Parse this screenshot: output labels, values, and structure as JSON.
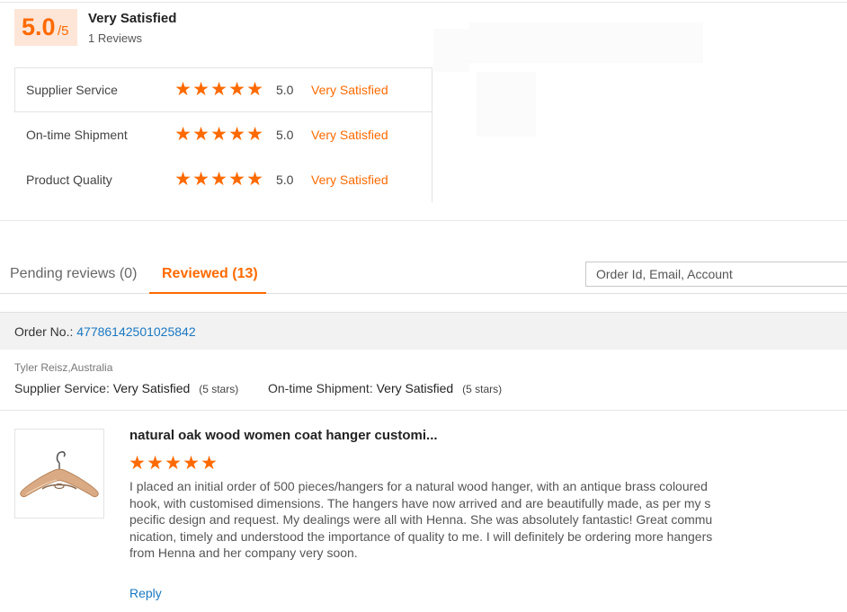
{
  "summary": {
    "score": "5.0",
    "score_max": "/5",
    "rating_text": "Very Satisfied",
    "review_count": "1 Reviews"
  },
  "rating_rows": [
    {
      "label": "Supplier Service",
      "stars": 5,
      "score": "5.0",
      "text": "Very Satisfied"
    },
    {
      "label": "On-time Shipment",
      "stars": 5,
      "score": "5.0",
      "text": "Very Satisfied"
    },
    {
      "label": "Product Quality",
      "stars": 5,
      "score": "5.0",
      "text": "Very Satisfied"
    }
  ],
  "tabs": {
    "pending": "Pending reviews (0)",
    "reviewed": "Reviewed (13)"
  },
  "search": {
    "placeholder": "Order Id, Email, Account"
  },
  "order": {
    "label": "Order No.:",
    "number": "47786142501025842"
  },
  "review": {
    "buyer": "Tyler Reisz,Australia",
    "supplier_label": "Supplier Service:",
    "supplier_value": "Very Satisfied",
    "supplier_stars": "(5 stars)",
    "shipment_label": "On-time Shipment:",
    "shipment_value": "Very Satisfied",
    "shipment_stars": "(5 stars)",
    "product_title": "natural oak wood women coat hanger customi...",
    "stars": 5,
    "text": "I placed an initial order of 500 pieces/hangers for a natural wood hanger, with an antique brass coloured hook, with customised dimensions. The hangers have now arrived and are beautifully made, as per my specific design and request. My dealings were all with Henna. She was absolutely fantastic! Great communication, timely and understood the importance of quality to me. I will definitely be ordering more hangers from Henna and her company very soon.",
    "reply_label": "Reply"
  },
  "colors": {
    "accent": "#ff6a00",
    "link": "#1a78c2"
  },
  "icons": {
    "star": "star-icon",
    "product_image": "wooden-hanger"
  }
}
